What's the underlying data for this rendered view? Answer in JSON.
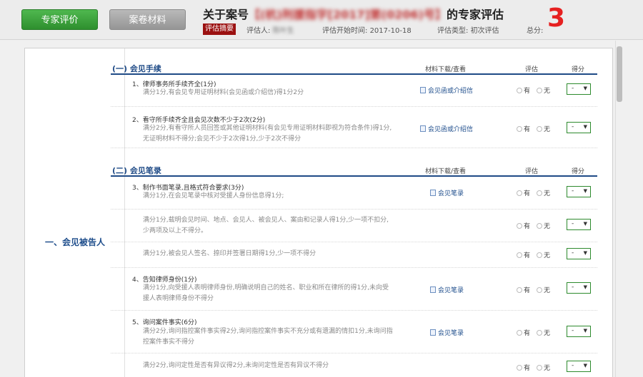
{
  "header": {
    "tab_expert": "专家评价",
    "tab_case": "案卷材料",
    "title_prefix": "关于案号",
    "title_case_no": "【(杭)刑援指字[2017]第(0206)号】",
    "title_suffix": "的专家评估",
    "summary_badge": "评估摘要",
    "assessor_label": "评估人:",
    "assessor_value": "陈叶生",
    "start_time_label": "评估开始时间:",
    "start_time_value": "2017-10-18",
    "type_label": "评估类型:",
    "type_value": "初次评估",
    "total_label": "总分:",
    "total_value": "3"
  },
  "category": "一、会见被告人",
  "sections": [
    {
      "title": "(一)  会见手续",
      "col_material": "材料下载/查看",
      "col_eval": "评估",
      "col_score": "得分"
    },
    {
      "title": "(二)  会见笔录",
      "col_material": "材料下载/查看",
      "col_eval": "评估",
      "col_score": "得分"
    }
  ],
  "radio_yes": "有",
  "radio_no": "无",
  "items": [
    {
      "name": "1、律师事务所手续齐全(1分)",
      "desc": "满分1分,有会见专用证明材料(会见函或介绍信)得1分2分",
      "link": "会见函或介绍信",
      "score": "-"
    },
    {
      "name": "2、看守所手续齐全且会见次数不少于2次(2分)",
      "desc": "满分2分,有看守所人员回签或其他证明材料(有会见专用证明材料即视为符合条件)得1分,无证明材料不得分;会见不少于2次得1分,少于2次不得分",
      "link": "会见函或介绍信",
      "score": "-"
    },
    {
      "name": "3、制作书面笔录,且格式符合要求(3分)",
      "desc": "满分1分,在会见笔录中核对受援人身份信息得1分;",
      "link": "会见笔录",
      "score": "-"
    },
    {
      "name": "",
      "desc": "满分1分,载明会见时间、地点、会见人、被会见人、案由和记录人得1分,少一项不扣分,少两项及以上不得分。",
      "link": "",
      "score": "-"
    },
    {
      "name": "",
      "desc": "满分1分,被会见人签名、捺印并签署日期得1分,少一项不得分",
      "link": "",
      "score": "-"
    },
    {
      "name": "4、告知律师身份(1分)",
      "desc": "满分1分,向受援人表明律师身份,明确说明自己的姓名、职业和所在律所的得1分,未向受援人表明律师身份不得分",
      "link": "会见笔录",
      "score": "-"
    },
    {
      "name": "5、询问案件事实(6分)",
      "desc": "满分2分,询问指控案件事实得2分,询问指控案件事实不充分或有遗漏的情扣1分,未询问指控案件事实不得分",
      "link": "会见笔录",
      "score": "-"
    },
    {
      "name": "",
      "desc": "满分2分,询问定性是否有异议得2分,未询问定性是否有异议不得分",
      "link": "",
      "score": "-"
    }
  ]
}
